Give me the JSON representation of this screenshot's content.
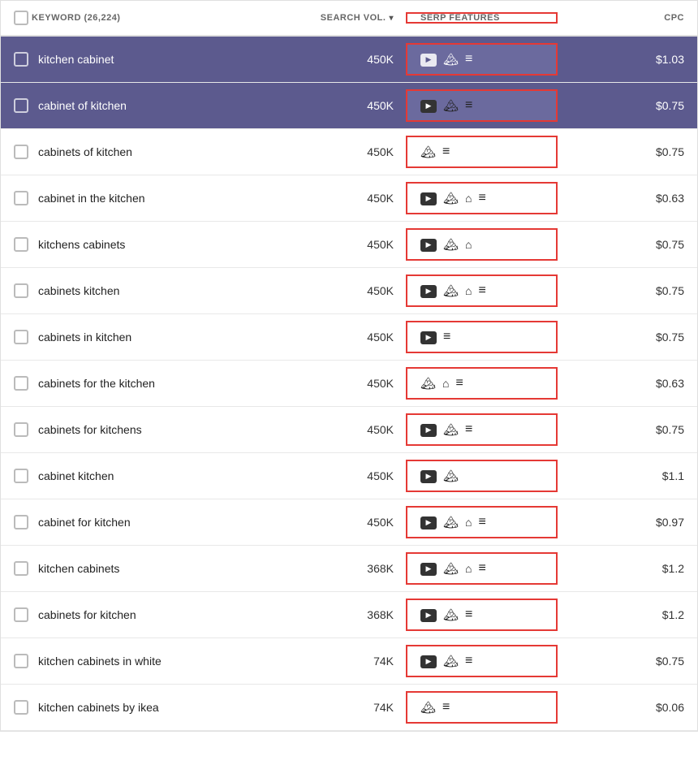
{
  "header": {
    "keyword_col": "KEYWORD (26,224)",
    "search_vol_col": "SEARCH VOL.",
    "serp_col": "SERP FEATURES",
    "cpc_col": "CPC"
  },
  "rows": [
    {
      "keyword": "kitchen cabinet",
      "vol": "450K",
      "features": [
        "video",
        "image",
        "list"
      ],
      "cpc": "$1.03",
      "highlighted": true
    },
    {
      "keyword": "cabinet of kitchen",
      "vol": "450K",
      "features": [
        "video",
        "image",
        "list"
      ],
      "cpc": "$0.75",
      "highlighted": false
    },
    {
      "keyword": "cabinets of kitchen",
      "vol": "450K",
      "features": [
        "image",
        "list"
      ],
      "cpc": "$0.75",
      "highlighted": false
    },
    {
      "keyword": "cabinet in the kitchen",
      "vol": "450K",
      "features": [
        "video",
        "image",
        "shop",
        "list"
      ],
      "cpc": "$0.63",
      "highlighted": false
    },
    {
      "keyword": "kitchens cabinets",
      "vol": "450K",
      "features": [
        "video",
        "image",
        "shop"
      ],
      "cpc": "$0.75",
      "highlighted": false
    },
    {
      "keyword": "cabinets kitchen",
      "vol": "450K",
      "features": [
        "video",
        "image",
        "shop",
        "list"
      ],
      "cpc": "$0.75",
      "highlighted": false
    },
    {
      "keyword": "cabinets in kitchen",
      "vol": "450K",
      "features": [
        "video",
        "list"
      ],
      "cpc": "$0.75",
      "highlighted": false
    },
    {
      "keyword": "cabinets for the kitchen",
      "vol": "450K",
      "features": [
        "image",
        "shop",
        "list"
      ],
      "cpc": "$0.63",
      "highlighted": false
    },
    {
      "keyword": "cabinets for kitchens",
      "vol": "450K",
      "features": [
        "video",
        "image",
        "list"
      ],
      "cpc": "$0.75",
      "highlighted": false
    },
    {
      "keyword": "cabinet kitchen",
      "vol": "450K",
      "features": [
        "video",
        "image"
      ],
      "cpc": "$1.1",
      "highlighted": false
    },
    {
      "keyword": "cabinet for kitchen",
      "vol": "450K",
      "features": [
        "video",
        "image",
        "shop",
        "list"
      ],
      "cpc": "$0.97",
      "highlighted": false
    },
    {
      "keyword": "kitchen cabinets",
      "vol": "368K",
      "features": [
        "video",
        "image",
        "shop",
        "list"
      ],
      "cpc": "$1.2",
      "highlighted": false
    },
    {
      "keyword": "cabinets for kitchen",
      "vol": "368K",
      "features": [
        "video",
        "image",
        "list"
      ],
      "cpc": "$1.2",
      "highlighted": false
    },
    {
      "keyword": "kitchen cabinets in white",
      "vol": "74K",
      "features": [
        "video",
        "image",
        "list"
      ],
      "cpc": "$0.75",
      "highlighted": false
    },
    {
      "keyword": "kitchen cabinets by ikea",
      "vol": "74K",
      "features": [
        "image",
        "list"
      ],
      "cpc": "$0.06",
      "highlighted": false
    }
  ],
  "icons": {
    "video": "▶",
    "image": "🏔",
    "list": "≡",
    "shop": "🛒"
  }
}
